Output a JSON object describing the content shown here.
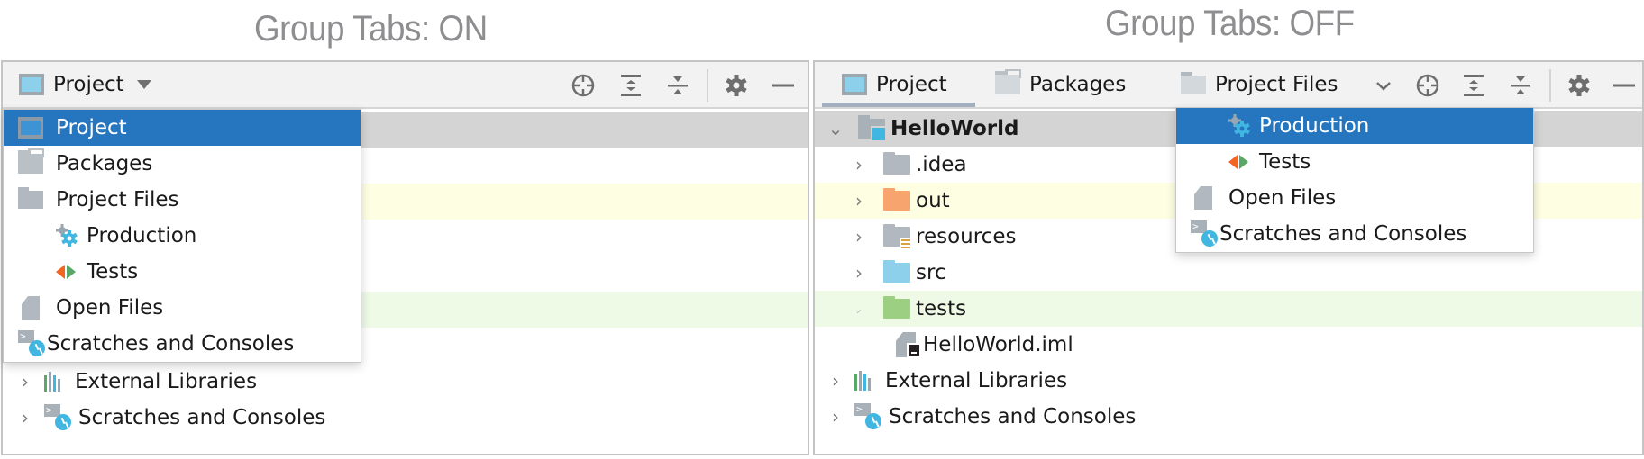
{
  "captions": {
    "left": "Group Tabs: ON",
    "right": "Group Tabs: OFF"
  },
  "colors": {
    "selection": "#2675bf",
    "caption": "#8e8e91",
    "row_yellow": "#fefee3",
    "row_green": "#eef9e6",
    "row_selected_gray": "#d4d4d4",
    "tab_underline": "#a3afbe"
  },
  "left_panel": {
    "view_selector": {
      "label": "Project",
      "icon": "project-icon",
      "dropdown": "triangle-down-icon"
    },
    "toolbar_icons": [
      "locate-icon",
      "expand-all-icon",
      "collapse-all-icon",
      "gear-icon",
      "minimize-icon"
    ],
    "popup": {
      "items": [
        {
          "label": "Project",
          "icon": "project-icon",
          "selected": true,
          "indent": 0
        },
        {
          "label": "Packages",
          "icon": "packages-icon",
          "selected": false,
          "indent": 0
        },
        {
          "label": "Project Files",
          "icon": "folder-icon",
          "selected": false,
          "indent": 0
        },
        {
          "label": "Production",
          "icon": "production-gear-icon",
          "selected": false,
          "indent": 1
        },
        {
          "label": "Tests",
          "icon": "tests-icon",
          "selected": false,
          "indent": 1
        },
        {
          "label": "Open Files",
          "icon": "file-icon",
          "selected": false,
          "indent": 0
        },
        {
          "label": "Scratches and Consoles",
          "icon": "scratches-icon",
          "selected": false,
          "indent": 0
        }
      ]
    },
    "tree_visible": [
      {
        "label": "External Libraries",
        "icon": "external-libraries-icon",
        "expandable": true
      },
      {
        "label": "Scratches and Consoles",
        "icon": "scratches-icon",
        "expandable": true
      }
    ]
  },
  "right_panel": {
    "tabs": [
      {
        "label": "Project",
        "icon": "project-icon",
        "active": true
      },
      {
        "label": "Packages",
        "icon": "packages-icon",
        "active": false
      },
      {
        "label": "Project Files",
        "icon": "folder-icon",
        "active": false
      }
    ],
    "tab_dropdown": "chevron-down-icon",
    "toolbar_icons": [
      "locate-icon",
      "expand-all-icon",
      "collapse-all-icon",
      "gear-icon",
      "minimize-icon"
    ],
    "tree": [
      {
        "label": "HelloWorld",
        "icon": "module-folder-icon",
        "expanded": true,
        "bold": true,
        "level": 0
      },
      {
        "label": ".idea",
        "icon": "folder-icon",
        "expandable": true,
        "level": 1
      },
      {
        "label": "out",
        "icon": "excluded-folder-icon",
        "expandable": true,
        "level": 1
      },
      {
        "label": "resources",
        "icon": "resources-folder-icon",
        "expandable": true,
        "level": 1
      },
      {
        "label": "src",
        "icon": "source-folder-icon",
        "expandable": true,
        "level": 1
      },
      {
        "label": "tests",
        "icon": "test-folder-icon",
        "expandable": false,
        "level": 1
      },
      {
        "label": "HelloWorld.iml",
        "icon": "iml-file-icon",
        "expandable": false,
        "level": 1
      },
      {
        "label": "External Libraries",
        "icon": "external-libraries-icon",
        "expandable": true,
        "level": 0
      },
      {
        "label": "Scratches and Consoles",
        "icon": "scratches-icon",
        "expandable": true,
        "level": 0
      }
    ],
    "popup": {
      "items": [
        {
          "label": "Production",
          "icon": "production-gear-icon",
          "selected": true,
          "indent": 1
        },
        {
          "label": "Tests",
          "icon": "tests-icon",
          "selected": false,
          "indent": 1
        },
        {
          "label": "Open Files",
          "icon": "file-icon",
          "selected": false,
          "indent": 0
        },
        {
          "label": "Scratches and Consoles",
          "icon": "scratches-icon",
          "selected": false,
          "indent": 0
        }
      ]
    }
  }
}
